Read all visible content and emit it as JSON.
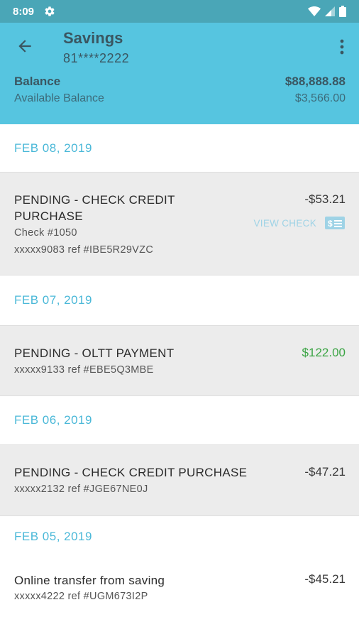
{
  "status": {
    "time": "8:09"
  },
  "header": {
    "title": "Savings",
    "account": "81****2222",
    "balance_label": "Balance",
    "balance_value": "$88,888.88",
    "available_label": "Available Balance",
    "available_value": "$3,566.00"
  },
  "groups": [
    {
      "date": "FEB 08, 2019",
      "transactions": [
        {
          "desc_line1": "PENDING - CHECK CREDIT",
          "desc_line2": "PURCHASE",
          "check": "Check #1050",
          "ref": "xxxxx9083 ref #IBE5R29VZC",
          "amount": "-$53.21",
          "action": "VIEW CHECK"
        }
      ]
    },
    {
      "date": "FEB 07, 2019",
      "transactions": [
        {
          "desc": "PENDING - OLTT PAYMENT",
          "ref": "xxxxx9133 ref #EBE5Q3MBE",
          "amount": "$122.00"
        }
      ]
    },
    {
      "date": "FEB 06, 2019",
      "transactions": [
        {
          "desc": "PENDING - CHECK CREDIT PURCHASE",
          "ref": "xxxxx2132 ref #JGE67NE0J",
          "amount": "-$47.21"
        }
      ]
    },
    {
      "date": "FEB 05, 2019",
      "transactions": [
        {
          "desc": "Online transfer from saving",
          "ref": "xxxxx4222 ref #UGM673I2P",
          "amount": "-$45.21"
        }
      ]
    }
  ],
  "colors": {
    "header": "#56c5e0",
    "status_bar": "#4aa6b7",
    "date_text": "#4ab8d8",
    "positive": "#3aa443"
  },
  "icons": [
    "gear-icon",
    "wifi-icon",
    "signal-icon",
    "battery-icon",
    "back-arrow-icon",
    "more-vert-icon",
    "check-icon"
  ]
}
